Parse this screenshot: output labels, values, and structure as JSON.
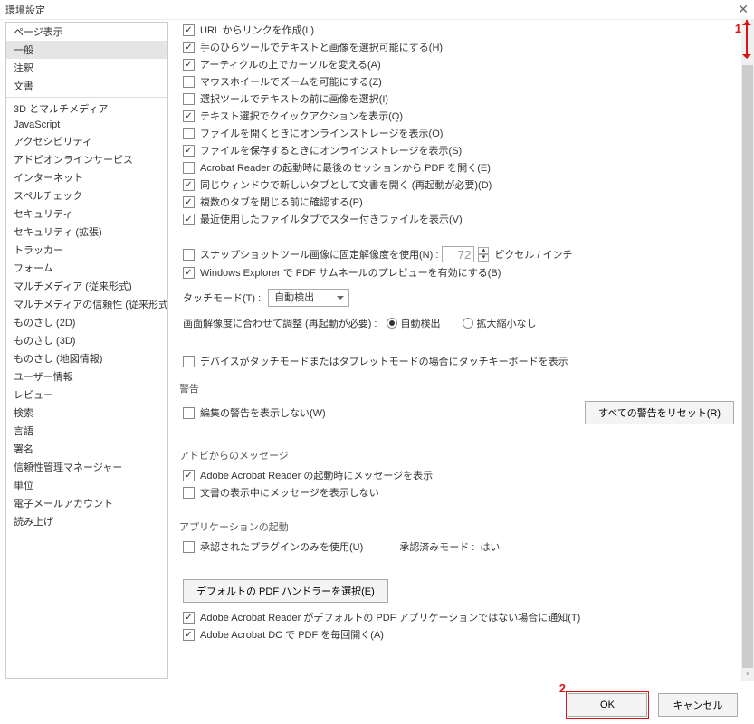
{
  "title": "環境設定",
  "sidebar": {
    "items": [
      {
        "label": "ページ表示"
      },
      {
        "label": "一般",
        "selected": true
      },
      {
        "label": "注釈"
      },
      {
        "label": "文書"
      },
      {
        "sep": true
      },
      {
        "label": "3D とマルチメディア"
      },
      {
        "label": "JavaScript"
      },
      {
        "label": "アクセシビリティ"
      },
      {
        "label": "アドビオンラインサービス"
      },
      {
        "label": "インターネット"
      },
      {
        "label": "スペルチェック"
      },
      {
        "label": "セキュリティ"
      },
      {
        "label": "セキュリティ (拡張)"
      },
      {
        "label": "トラッカー"
      },
      {
        "label": "フォーム"
      },
      {
        "label": "マルチメディア (従来形式)"
      },
      {
        "label": "マルチメディアの信頼性 (従来形式)"
      },
      {
        "label": "ものさし (2D)"
      },
      {
        "label": "ものさし (3D)"
      },
      {
        "label": "ものさし (地図情報)"
      },
      {
        "label": "ユーザー情報"
      },
      {
        "label": "レビュー"
      },
      {
        "label": "検索"
      },
      {
        "label": "言語"
      },
      {
        "label": "署名"
      },
      {
        "label": "信頼性管理マネージャー"
      },
      {
        "label": "単位"
      },
      {
        "label": "電子メールアカウント"
      },
      {
        "label": "読み上げ"
      }
    ]
  },
  "options": {
    "c1": {
      "checked": true,
      "label": "URL からリンクを作成(L)"
    },
    "c2": {
      "checked": true,
      "label": "手のひらツールでテキストと画像を選択可能にする(H)"
    },
    "c3": {
      "checked": true,
      "label": "アーティクルの上でカーソルを変える(A)"
    },
    "c4": {
      "checked": false,
      "label": "マウスホイールでズームを可能にする(Z)"
    },
    "c5": {
      "checked": false,
      "label": "選択ツールでテキストの前に画像を選択(I)"
    },
    "c6": {
      "checked": true,
      "label": "テキスト選択でクイックアクションを表示(Q)"
    },
    "c7": {
      "checked": false,
      "label": "ファイルを開くときにオンラインストレージを表示(O)"
    },
    "c8": {
      "checked": true,
      "label": "ファイルを保存するときにオンラインストレージを表示(S)"
    },
    "c9": {
      "checked": false,
      "label": "Acrobat Reader の起動時に最後のセッションから PDF を開く(E)"
    },
    "c10": {
      "checked": true,
      "label": "同じウィンドウで新しいタブとして文書を開く (再起動が必要)(D)"
    },
    "c11": {
      "checked": true,
      "label": "複数のタブを閉じる前に確認する(P)"
    },
    "c12": {
      "checked": true,
      "label": "最近使用したファイルタブでスター付きファイルを表示(V)"
    },
    "snapshot": {
      "checked": false,
      "label": "スナップショットツール画像に固定解像度を使用(N) :",
      "value": "72",
      "unit": "ピクセル / インチ"
    },
    "explorer": {
      "checked": true,
      "label": "Windows Explorer で PDF サムネールのプレビューを有効にする(B)"
    },
    "touch_label": "タッチモード(T) :",
    "touch_value": "自動検出",
    "scale_label": "画面解像度に合わせて調整 (再起動が必要) :",
    "scale_r1": "自動検出",
    "scale_r2": "拡大縮小なし",
    "tablet": {
      "checked": false,
      "label": "デバイスがタッチモードまたはタブレットモードの場合にタッチキーボードを表示"
    }
  },
  "warnings": {
    "title": "警告",
    "hide": {
      "checked": false,
      "label": "編集の警告を表示しない(W)"
    },
    "reset_btn": "すべての警告をリセット(R)"
  },
  "adobe_msg": {
    "title": "アドビからのメッセージ",
    "m1": {
      "checked": true,
      "label": "Adobe Acrobat Reader の起動時にメッセージを表示"
    },
    "m2": {
      "checked": false,
      "label": "文書の表示中にメッセージを表示しない"
    }
  },
  "app_start": {
    "title": "アプリケーションの起動",
    "plugins": {
      "checked": false,
      "label": "承認されたプラグインのみを使用(U)"
    },
    "mode_label": "承認済みモード :",
    "mode_value": "はい",
    "handler_btn": "デフォルトの PDF ハンドラーを選択(E)",
    "notify": {
      "checked": true,
      "label": "Adobe Acrobat Reader がデフォルトの PDF アプリケーションではない場合に通知(T)"
    },
    "always": {
      "checked": true,
      "label": "Adobe Acrobat DC で PDF を毎回開く(A)"
    }
  },
  "footer": {
    "ok": "OK",
    "cancel": "キャンセル"
  },
  "annotations": {
    "a1": "1",
    "a2": "2"
  }
}
